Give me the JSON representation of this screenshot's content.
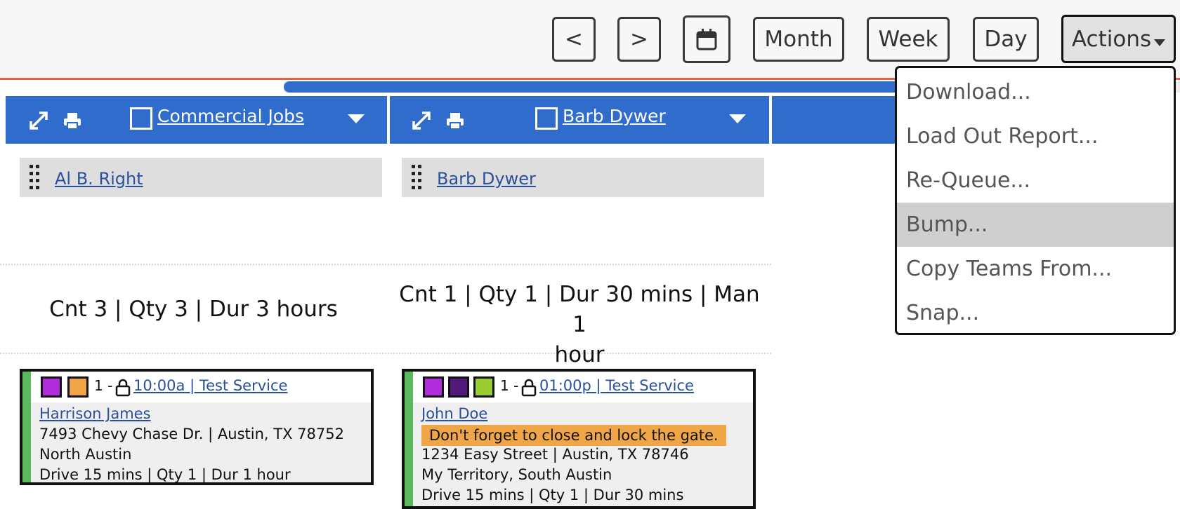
{
  "toolbar": {
    "prev_label": "<",
    "next_label": ">",
    "calendar_icon": "calendar-icon",
    "month_label": "Month",
    "week_label": "Week",
    "day_label": "Day",
    "actions_label": "Actions"
  },
  "actions_menu": {
    "items": [
      "Download...",
      "Load Out Report...",
      "Re-Queue...",
      "Bump...",
      "Copy Teams From...",
      "Snap..."
    ],
    "highlighted_item": "Bump..."
  },
  "columns": [
    {
      "title": "Commercial Jobs",
      "team": "Al B. Right",
      "summary": "Cnt 3 | Qty 3 | Dur 3 hours",
      "job": {
        "tag_colors": [
          "#b12cdc",
          "#f0a646"
        ],
        "index": "1 -",
        "time_link": "10:00a | Test Service",
        "customer": "Harrison James",
        "address": "7493 Chevy Chase Dr. | Austin, TX 78752",
        "territory": "North Austin",
        "details": "Drive 15 mins | Qty 1 | Dur 1 hour"
      }
    },
    {
      "title": "Barb Dywer",
      "team": "Barb Dywer",
      "summary_line1": "Cnt 1 | Qty 1 | Dur 30 mins | Man 1",
      "summary_line2": "hour",
      "job": {
        "tag_colors": [
          "#b12cdc",
          "#52187a",
          "#9acd32"
        ],
        "index": "1 -",
        "time_link": "01:00p | Test Service",
        "customer": "John Doe",
        "note": "Don't forget to close and lock the gate.",
        "address": "1234 Easy Street | Austin, TX 78746",
        "territory": "My Territory, South Austin",
        "details": "Drive 15 mins | Qty 1 | Dur 30 mins"
      }
    }
  ],
  "colors": {
    "header_blue": "#2f6ccb",
    "accent_orange": "#e8603c",
    "stripe_green": "#5cb85c",
    "note_orange": "#f0a646",
    "link_blue": "#2a4f9c"
  }
}
